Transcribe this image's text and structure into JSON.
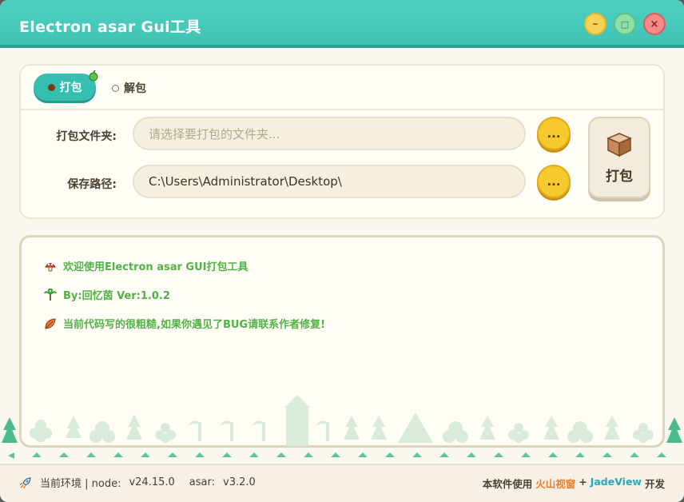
{
  "window": {
    "title": "Electron asar Gui工具",
    "minimize_glyph": "–",
    "maximize_glyph": "□",
    "close_glyph": "×"
  },
  "tabs": [
    {
      "label": "打包",
      "selected": true
    },
    {
      "label": "解包",
      "selected": false
    }
  ],
  "form": {
    "folder_label": "打包文件夹:",
    "folder_placeholder": "请选择要打包的文件夹...",
    "save_label": "保存路径:",
    "save_value": "C:\\Users\\Administrator\\Desktop\\",
    "browse_label": "...",
    "pack_button_label": "打包"
  },
  "log": [
    {
      "icon": "mushroom-icon",
      "text": "欢迎使用Electron asar GUI打包工具"
    },
    {
      "icon": "palm-tree-icon",
      "text": "By:回忆茵    Ver:1.0.2"
    },
    {
      "icon": "leaf-icon",
      "text": "当前代码写的很粗糙,如果你遇见了BUG请联系作者修复!"
    }
  ],
  "status": {
    "env_label": "当前环境 | node:",
    "node_version": "v24.15.0",
    "asar_label": "asar:",
    "asar_version": "v3.2.0",
    "credit_prefix": "本软件使用",
    "credit_brand1": "火山视窗",
    "credit_plus": "+",
    "credit_brand2": "JadeView",
    "credit_suffix": "开发"
  },
  "colors": {
    "accent": "#3fc3b5",
    "log_text": "#52b248",
    "brand1": "#f07a2c",
    "brand2": "#2aa8b8"
  }
}
